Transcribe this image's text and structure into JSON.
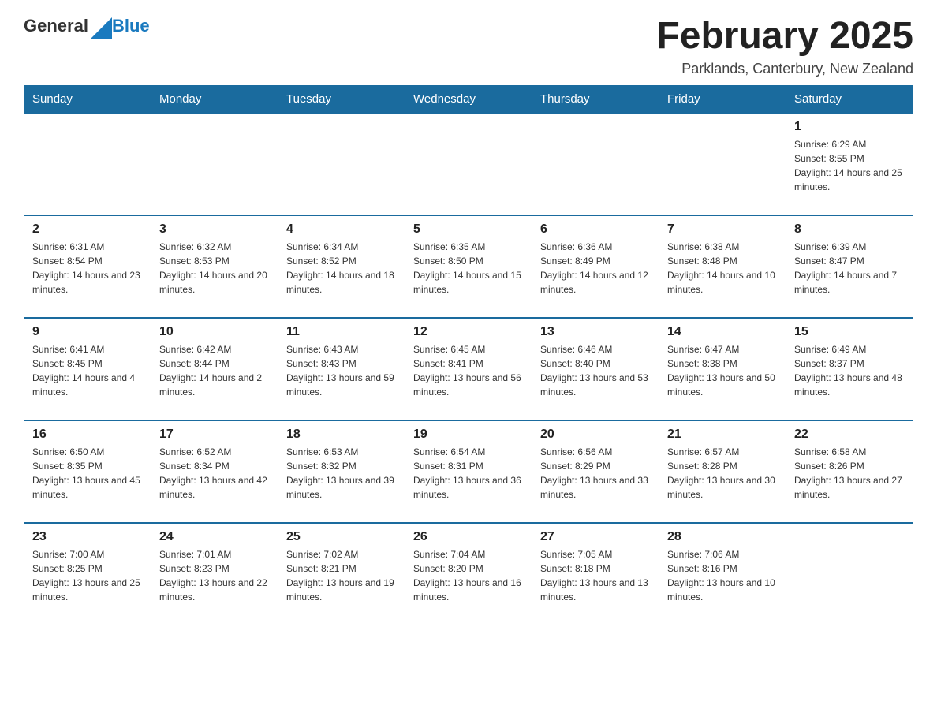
{
  "header": {
    "logo": {
      "text_general": "General",
      "text_blue": "Blue",
      "icon_alt": "GeneralBlue logo"
    },
    "title": "February 2025",
    "location": "Parklands, Canterbury, New Zealand"
  },
  "calendar": {
    "days_of_week": [
      "Sunday",
      "Monday",
      "Tuesday",
      "Wednesday",
      "Thursday",
      "Friday",
      "Saturday"
    ],
    "weeks": [
      [
        {
          "day": "",
          "info": ""
        },
        {
          "day": "",
          "info": ""
        },
        {
          "day": "",
          "info": ""
        },
        {
          "day": "",
          "info": ""
        },
        {
          "day": "",
          "info": ""
        },
        {
          "day": "",
          "info": ""
        },
        {
          "day": "1",
          "info": "Sunrise: 6:29 AM\nSunset: 8:55 PM\nDaylight: 14 hours and 25 minutes."
        }
      ],
      [
        {
          "day": "2",
          "info": "Sunrise: 6:31 AM\nSunset: 8:54 PM\nDaylight: 14 hours and 23 minutes."
        },
        {
          "day": "3",
          "info": "Sunrise: 6:32 AM\nSunset: 8:53 PM\nDaylight: 14 hours and 20 minutes."
        },
        {
          "day": "4",
          "info": "Sunrise: 6:34 AM\nSunset: 8:52 PM\nDaylight: 14 hours and 18 minutes."
        },
        {
          "day": "5",
          "info": "Sunrise: 6:35 AM\nSunset: 8:50 PM\nDaylight: 14 hours and 15 minutes."
        },
        {
          "day": "6",
          "info": "Sunrise: 6:36 AM\nSunset: 8:49 PM\nDaylight: 14 hours and 12 minutes."
        },
        {
          "day": "7",
          "info": "Sunrise: 6:38 AM\nSunset: 8:48 PM\nDaylight: 14 hours and 10 minutes."
        },
        {
          "day": "8",
          "info": "Sunrise: 6:39 AM\nSunset: 8:47 PM\nDaylight: 14 hours and 7 minutes."
        }
      ],
      [
        {
          "day": "9",
          "info": "Sunrise: 6:41 AM\nSunset: 8:45 PM\nDaylight: 14 hours and 4 minutes."
        },
        {
          "day": "10",
          "info": "Sunrise: 6:42 AM\nSunset: 8:44 PM\nDaylight: 14 hours and 2 minutes."
        },
        {
          "day": "11",
          "info": "Sunrise: 6:43 AM\nSunset: 8:43 PM\nDaylight: 13 hours and 59 minutes."
        },
        {
          "day": "12",
          "info": "Sunrise: 6:45 AM\nSunset: 8:41 PM\nDaylight: 13 hours and 56 minutes."
        },
        {
          "day": "13",
          "info": "Sunrise: 6:46 AM\nSunset: 8:40 PM\nDaylight: 13 hours and 53 minutes."
        },
        {
          "day": "14",
          "info": "Sunrise: 6:47 AM\nSunset: 8:38 PM\nDaylight: 13 hours and 50 minutes."
        },
        {
          "day": "15",
          "info": "Sunrise: 6:49 AM\nSunset: 8:37 PM\nDaylight: 13 hours and 48 minutes."
        }
      ],
      [
        {
          "day": "16",
          "info": "Sunrise: 6:50 AM\nSunset: 8:35 PM\nDaylight: 13 hours and 45 minutes."
        },
        {
          "day": "17",
          "info": "Sunrise: 6:52 AM\nSunset: 8:34 PM\nDaylight: 13 hours and 42 minutes."
        },
        {
          "day": "18",
          "info": "Sunrise: 6:53 AM\nSunset: 8:32 PM\nDaylight: 13 hours and 39 minutes."
        },
        {
          "day": "19",
          "info": "Sunrise: 6:54 AM\nSunset: 8:31 PM\nDaylight: 13 hours and 36 minutes."
        },
        {
          "day": "20",
          "info": "Sunrise: 6:56 AM\nSunset: 8:29 PM\nDaylight: 13 hours and 33 minutes."
        },
        {
          "day": "21",
          "info": "Sunrise: 6:57 AM\nSunset: 8:28 PM\nDaylight: 13 hours and 30 minutes."
        },
        {
          "day": "22",
          "info": "Sunrise: 6:58 AM\nSunset: 8:26 PM\nDaylight: 13 hours and 27 minutes."
        }
      ],
      [
        {
          "day": "23",
          "info": "Sunrise: 7:00 AM\nSunset: 8:25 PM\nDaylight: 13 hours and 25 minutes."
        },
        {
          "day": "24",
          "info": "Sunrise: 7:01 AM\nSunset: 8:23 PM\nDaylight: 13 hours and 22 minutes."
        },
        {
          "day": "25",
          "info": "Sunrise: 7:02 AM\nSunset: 8:21 PM\nDaylight: 13 hours and 19 minutes."
        },
        {
          "day": "26",
          "info": "Sunrise: 7:04 AM\nSunset: 8:20 PM\nDaylight: 13 hours and 16 minutes."
        },
        {
          "day": "27",
          "info": "Sunrise: 7:05 AM\nSunset: 8:18 PM\nDaylight: 13 hours and 13 minutes."
        },
        {
          "day": "28",
          "info": "Sunrise: 7:06 AM\nSunset: 8:16 PM\nDaylight: 13 hours and 10 minutes."
        },
        {
          "day": "",
          "info": ""
        }
      ]
    ]
  }
}
